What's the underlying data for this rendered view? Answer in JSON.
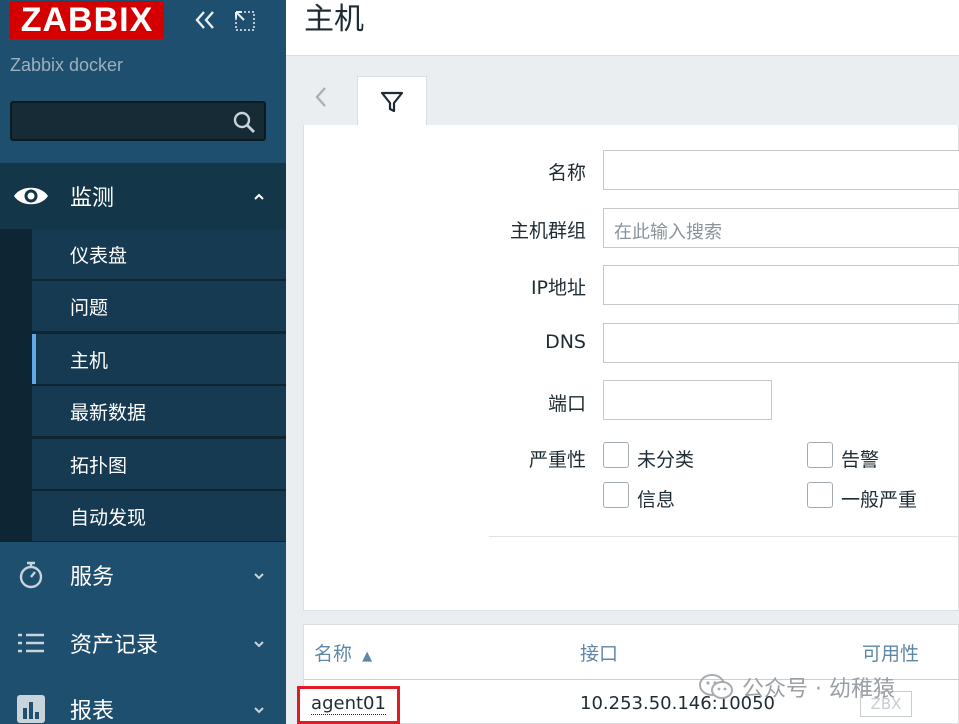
{
  "sidebar": {
    "logo": "ZABBIX",
    "server_name": "Zabbix docker",
    "search": {
      "value": "",
      "placeholder": ""
    },
    "menu": {
      "monitoring": "监测",
      "monitoring_items": [
        "仪表盘",
        "问题",
        "主机",
        "最新数据",
        "拓扑图",
        "自动发现"
      ],
      "active_item": "主机",
      "services": "服务",
      "inventory": "资产记录",
      "reports": "报表"
    }
  },
  "page": {
    "title": "主机"
  },
  "filter": {
    "labels": {
      "name": "名称",
      "host_groups": "主机群组",
      "ip": "IP地址",
      "dns": "DNS",
      "port": "端口",
      "severity": "严重性"
    },
    "host_groups_placeholder": "在此输入搜索",
    "severity_options": [
      "未分类",
      "告警",
      "信息",
      "一般严重"
    ]
  },
  "table": {
    "columns": {
      "name": "名称",
      "interface": "接口",
      "availability": "可用性"
    },
    "sort_indicator": "▲",
    "rows": [
      {
        "name": "agent01",
        "interface": "10.253.50.146:10050",
        "availability": "ZBX"
      }
    ]
  },
  "watermark": "公众号 · 幼稚猿",
  "colors": {
    "sidebar": "#1f4f6e",
    "logo_bg": "#d40000",
    "link": "#5f87a8",
    "highlight": "#e01b24"
  }
}
